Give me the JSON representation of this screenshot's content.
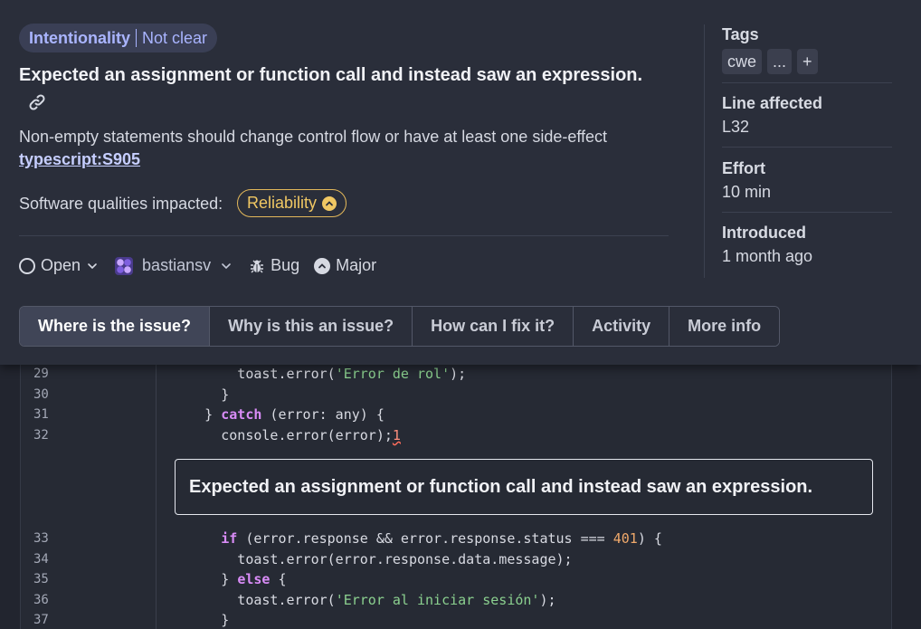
{
  "issue": {
    "attribute_category": "Intentionality",
    "attribute_value": "Not clear",
    "title": "Expected an assignment or function call and instead saw an expression.",
    "description": "Non-empty statements should change control flow or have at least one side-effect",
    "rule_key": "typescript:S905",
    "qualities_label": "Software qualities impacted:",
    "quality": "Reliability",
    "status": "Open",
    "assignee": "bastiansv",
    "type": "Bug",
    "severity": "Major"
  },
  "sidebar": {
    "tags_label": "Tags",
    "tags": [
      "cwe",
      "...",
      "+"
    ],
    "line_label": "Line affected",
    "line_value": "L32",
    "effort_label": "Effort",
    "effort_value": "10 min",
    "introduced_label": "Introduced",
    "introduced_value": "1 month ago"
  },
  "tabs": [
    {
      "label": "Where is the issue?",
      "active": true
    },
    {
      "label": "Why is this an issue?",
      "active": false
    },
    {
      "label": "How can I fix it?",
      "active": false
    },
    {
      "label": "Activity",
      "active": false
    },
    {
      "label": "More info",
      "active": false
    }
  ],
  "code": {
    "lines": [
      {
        "n": "29",
        "text": "          toast.error('Error de rol');"
      },
      {
        "n": "30",
        "text": "        }"
      },
      {
        "n": "31",
        "text": "      } catch (error: any) {"
      },
      {
        "n": "32",
        "text": "        console.error(error);1"
      },
      {
        "n": "33",
        "text": "        if (error.response && error.response.status === 401) {"
      },
      {
        "n": "34",
        "text": "          toast.error(error.response.data.message);"
      },
      {
        "n": "35",
        "text": "        } else {"
      },
      {
        "n": "36",
        "text": "          toast.error('Error al iniciar sesión');"
      },
      {
        "n": "37",
        "text": "        }"
      }
    ],
    "inline_message": "Expected an assignment or function call and instead saw an expression."
  },
  "colors": {
    "accent": "#a9b4ff",
    "reliability": "#f0c763",
    "keyword": "#d98cf7",
    "string": "#8bd08f",
    "number": "#f0a96b"
  }
}
